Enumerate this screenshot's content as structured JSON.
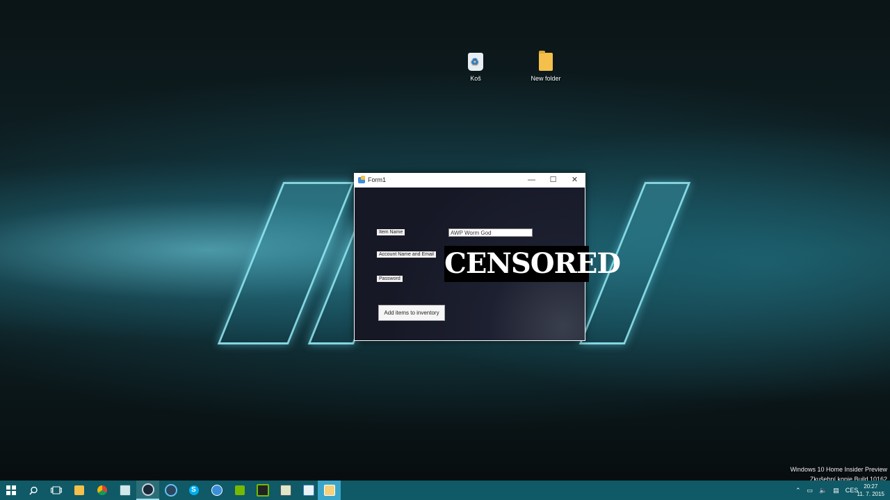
{
  "desktop": {
    "icons": [
      {
        "label": "Koš"
      },
      {
        "label": "New folder"
      }
    ]
  },
  "window": {
    "title": "Form1",
    "minimize": "—",
    "maximize": "☐",
    "close": "✕",
    "fields": {
      "item_name_label": "Item Name",
      "item_name_value": "AWP Worm God",
      "account_label": "Account Name and Email",
      "password_label": "Password"
    },
    "submit_label": "Add items to inventory"
  },
  "overlay": {
    "censor_text": "CENSORED"
  },
  "watermark": {
    "line1": "Windows 10 Home Insider Preview",
    "line2": "Zkušební kopie Build 10162"
  },
  "taskbar": {
    "apps": [
      {
        "icon": "start-icon"
      },
      {
        "icon": "search-icon"
      },
      {
        "icon": "task-view-icon"
      },
      {
        "icon": "file-explorer-icon"
      },
      {
        "icon": "chrome-icon"
      },
      {
        "icon": "app-icon"
      },
      {
        "icon": "steam-icon"
      },
      {
        "icon": "steam-alt-icon"
      },
      {
        "icon": "skype-icon"
      },
      {
        "icon": "browser-icon"
      },
      {
        "icon": "nvidia-icon"
      },
      {
        "icon": "nvidia-alt-icon"
      },
      {
        "icon": "notepad-icon"
      },
      {
        "icon": "media-icon"
      },
      {
        "icon": "explorer-window-icon"
      }
    ],
    "language": "CES",
    "time": "20:27",
    "date": "11. 7. 2015"
  }
}
